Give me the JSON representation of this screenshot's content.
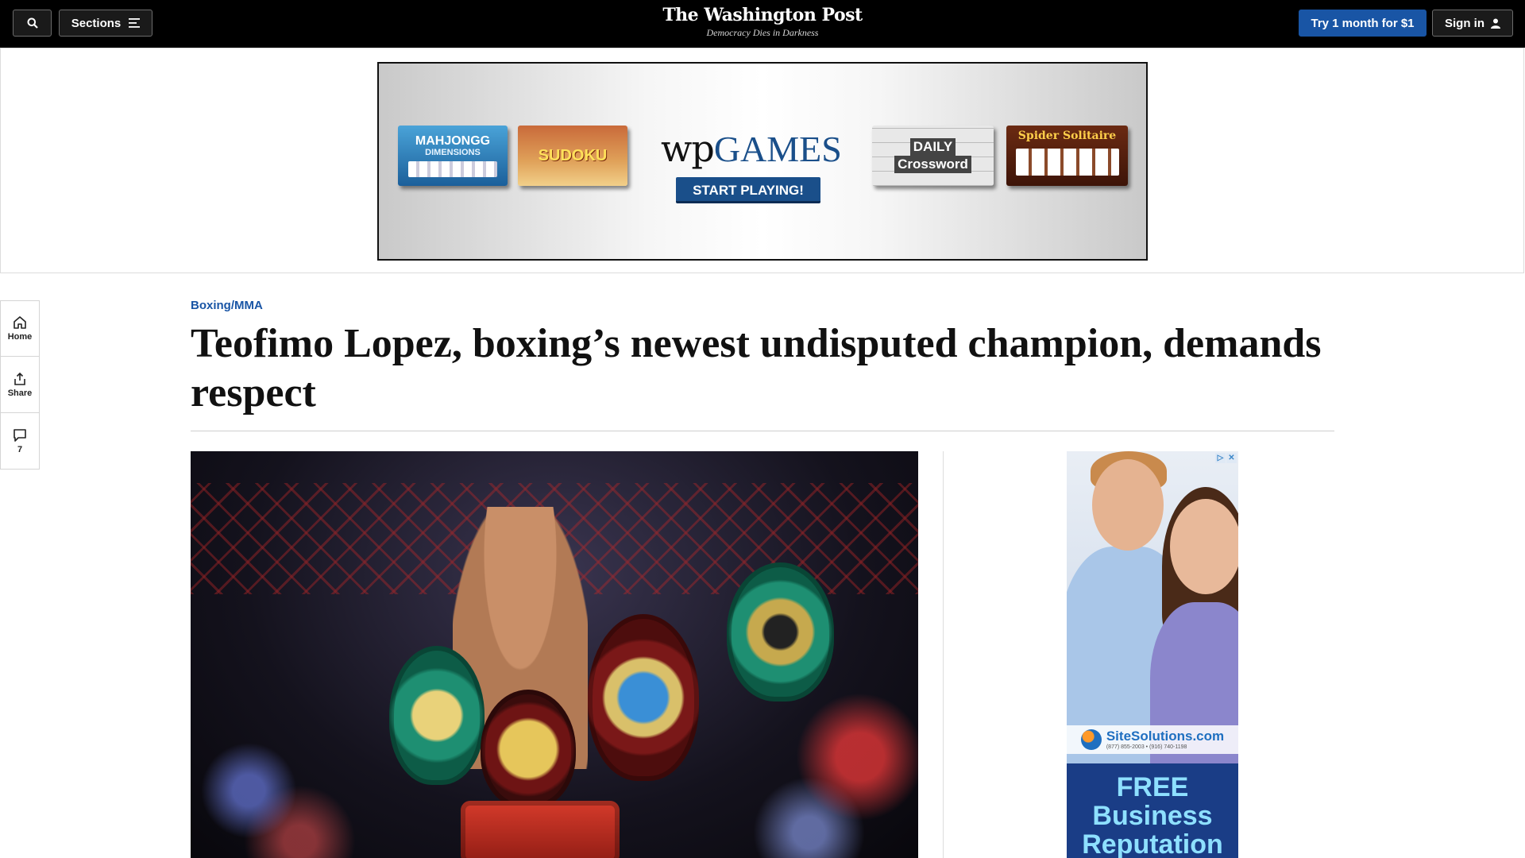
{
  "nav": {
    "sections_label": "Sections",
    "logo": "The Washington Post",
    "tagline": "Democracy Dies in Darkness",
    "subscribe_label": "Try 1 month for $1",
    "signin_label": "Sign in"
  },
  "banner_ad": {
    "tiles": {
      "mahjongg": "MAHJONGG",
      "mahjongg_sub": "DIMENSIONS",
      "sudoku": "SUDOKU",
      "crossword_line1": "DAILY",
      "crossword_line2": "Crossword",
      "spider": "Spider Solitaire"
    },
    "brand_wp": "wp",
    "brand_games": "GAMES",
    "cta": "START PLAYING!"
  },
  "rail": {
    "home": "Home",
    "share": "Share",
    "comments_count": "7"
  },
  "article": {
    "kicker": "Boxing/MMA",
    "headline": "Teofimo Lopez, boxing’s newest undisputed champion, demands respect"
  },
  "side_ad": {
    "choices": [
      "▷",
      "✕"
    ],
    "brand": "SiteSolutions.com",
    "phones": "(877) 855-2003 • (916) 740-1198",
    "headline": "FREE Business Reputation"
  }
}
